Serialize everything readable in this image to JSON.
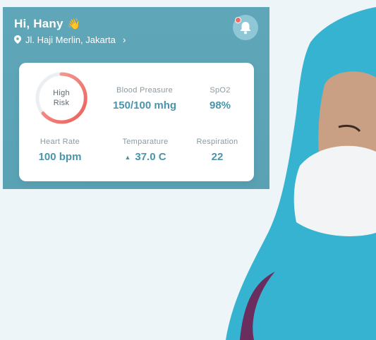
{
  "header": {
    "greeting": "Hi, Hany",
    "wave_icon": "waving-hand-icon",
    "location": "Jl. Haji Merlin, Jakarta",
    "location_icon": "map-pin-icon",
    "chevron_icon": "chevron-right-icon",
    "bell_icon": "bell-icon",
    "notification_dot_color": "#f06b66"
  },
  "vitals": {
    "risk": {
      "label": "High\nRisk",
      "color": "#f06b66"
    },
    "blood_pressure": {
      "label": "Blood Preasure",
      "value": "150/100 mhg"
    },
    "spo2": {
      "label": "SpO2",
      "value": "98%"
    },
    "heart_rate": {
      "label": "Heart Rate",
      "value": "100 bpm"
    },
    "temperature": {
      "label": "Temparature",
      "value": "37.0 C",
      "trend_icon": "triangle-up-icon"
    },
    "respiration": {
      "label": "Respiration",
      "value": "22"
    }
  },
  "colors": {
    "panel": "#5fa7b8",
    "accent": "#4a95ab",
    "background": "#eef5f8"
  }
}
